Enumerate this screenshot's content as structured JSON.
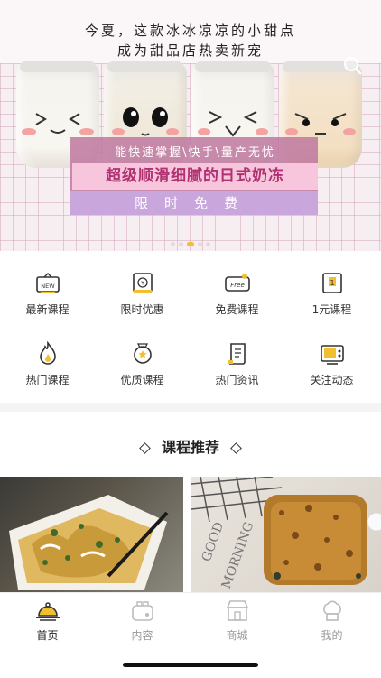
{
  "banner": {
    "headline_line1": "今夏，这款冰冰凉凉的小甜点",
    "headline_line2": "成为甜品店热卖新宠",
    "promo_line1": "能快速掌握\\快手\\量产无忧",
    "promo_line2": "超级顺滑细腻的日式奶冻",
    "promo_line3": "限时免费",
    "icons": {
      "search": "search-icon"
    },
    "pages": 5,
    "active_page": 2
  },
  "categories": [
    {
      "label": "最新课程",
      "icon": "new-badge-icon"
    },
    {
      "label": "限时优惠",
      "icon": "coupon-icon"
    },
    {
      "label": "免费课程",
      "icon": "free-ticket-icon"
    },
    {
      "label": "1元课程",
      "icon": "one-yuan-icon"
    },
    {
      "label": "热门课程",
      "icon": "flame-icon"
    },
    {
      "label": "优质课程",
      "icon": "medal-icon"
    },
    {
      "label": "热门资讯",
      "icon": "news-scroll-icon"
    },
    {
      "label": "关注动态",
      "icon": "tv-icon"
    }
  ],
  "section": {
    "title": "课程推荐"
  },
  "tabs": [
    {
      "label": "首页",
      "icon": "cloche-icon",
      "active": true
    },
    {
      "label": "内容",
      "icon": "toaster-icon",
      "active": false
    },
    {
      "label": "商城",
      "icon": "shop-icon",
      "active": false
    },
    {
      "label": "我的",
      "icon": "chef-hat-icon",
      "active": false
    }
  ],
  "colors": {
    "accent": "#f0c030",
    "promo_pink": "#f8c6dc",
    "promo_text": "#b03072",
    "promo_purple": "#c9a7dd"
  }
}
